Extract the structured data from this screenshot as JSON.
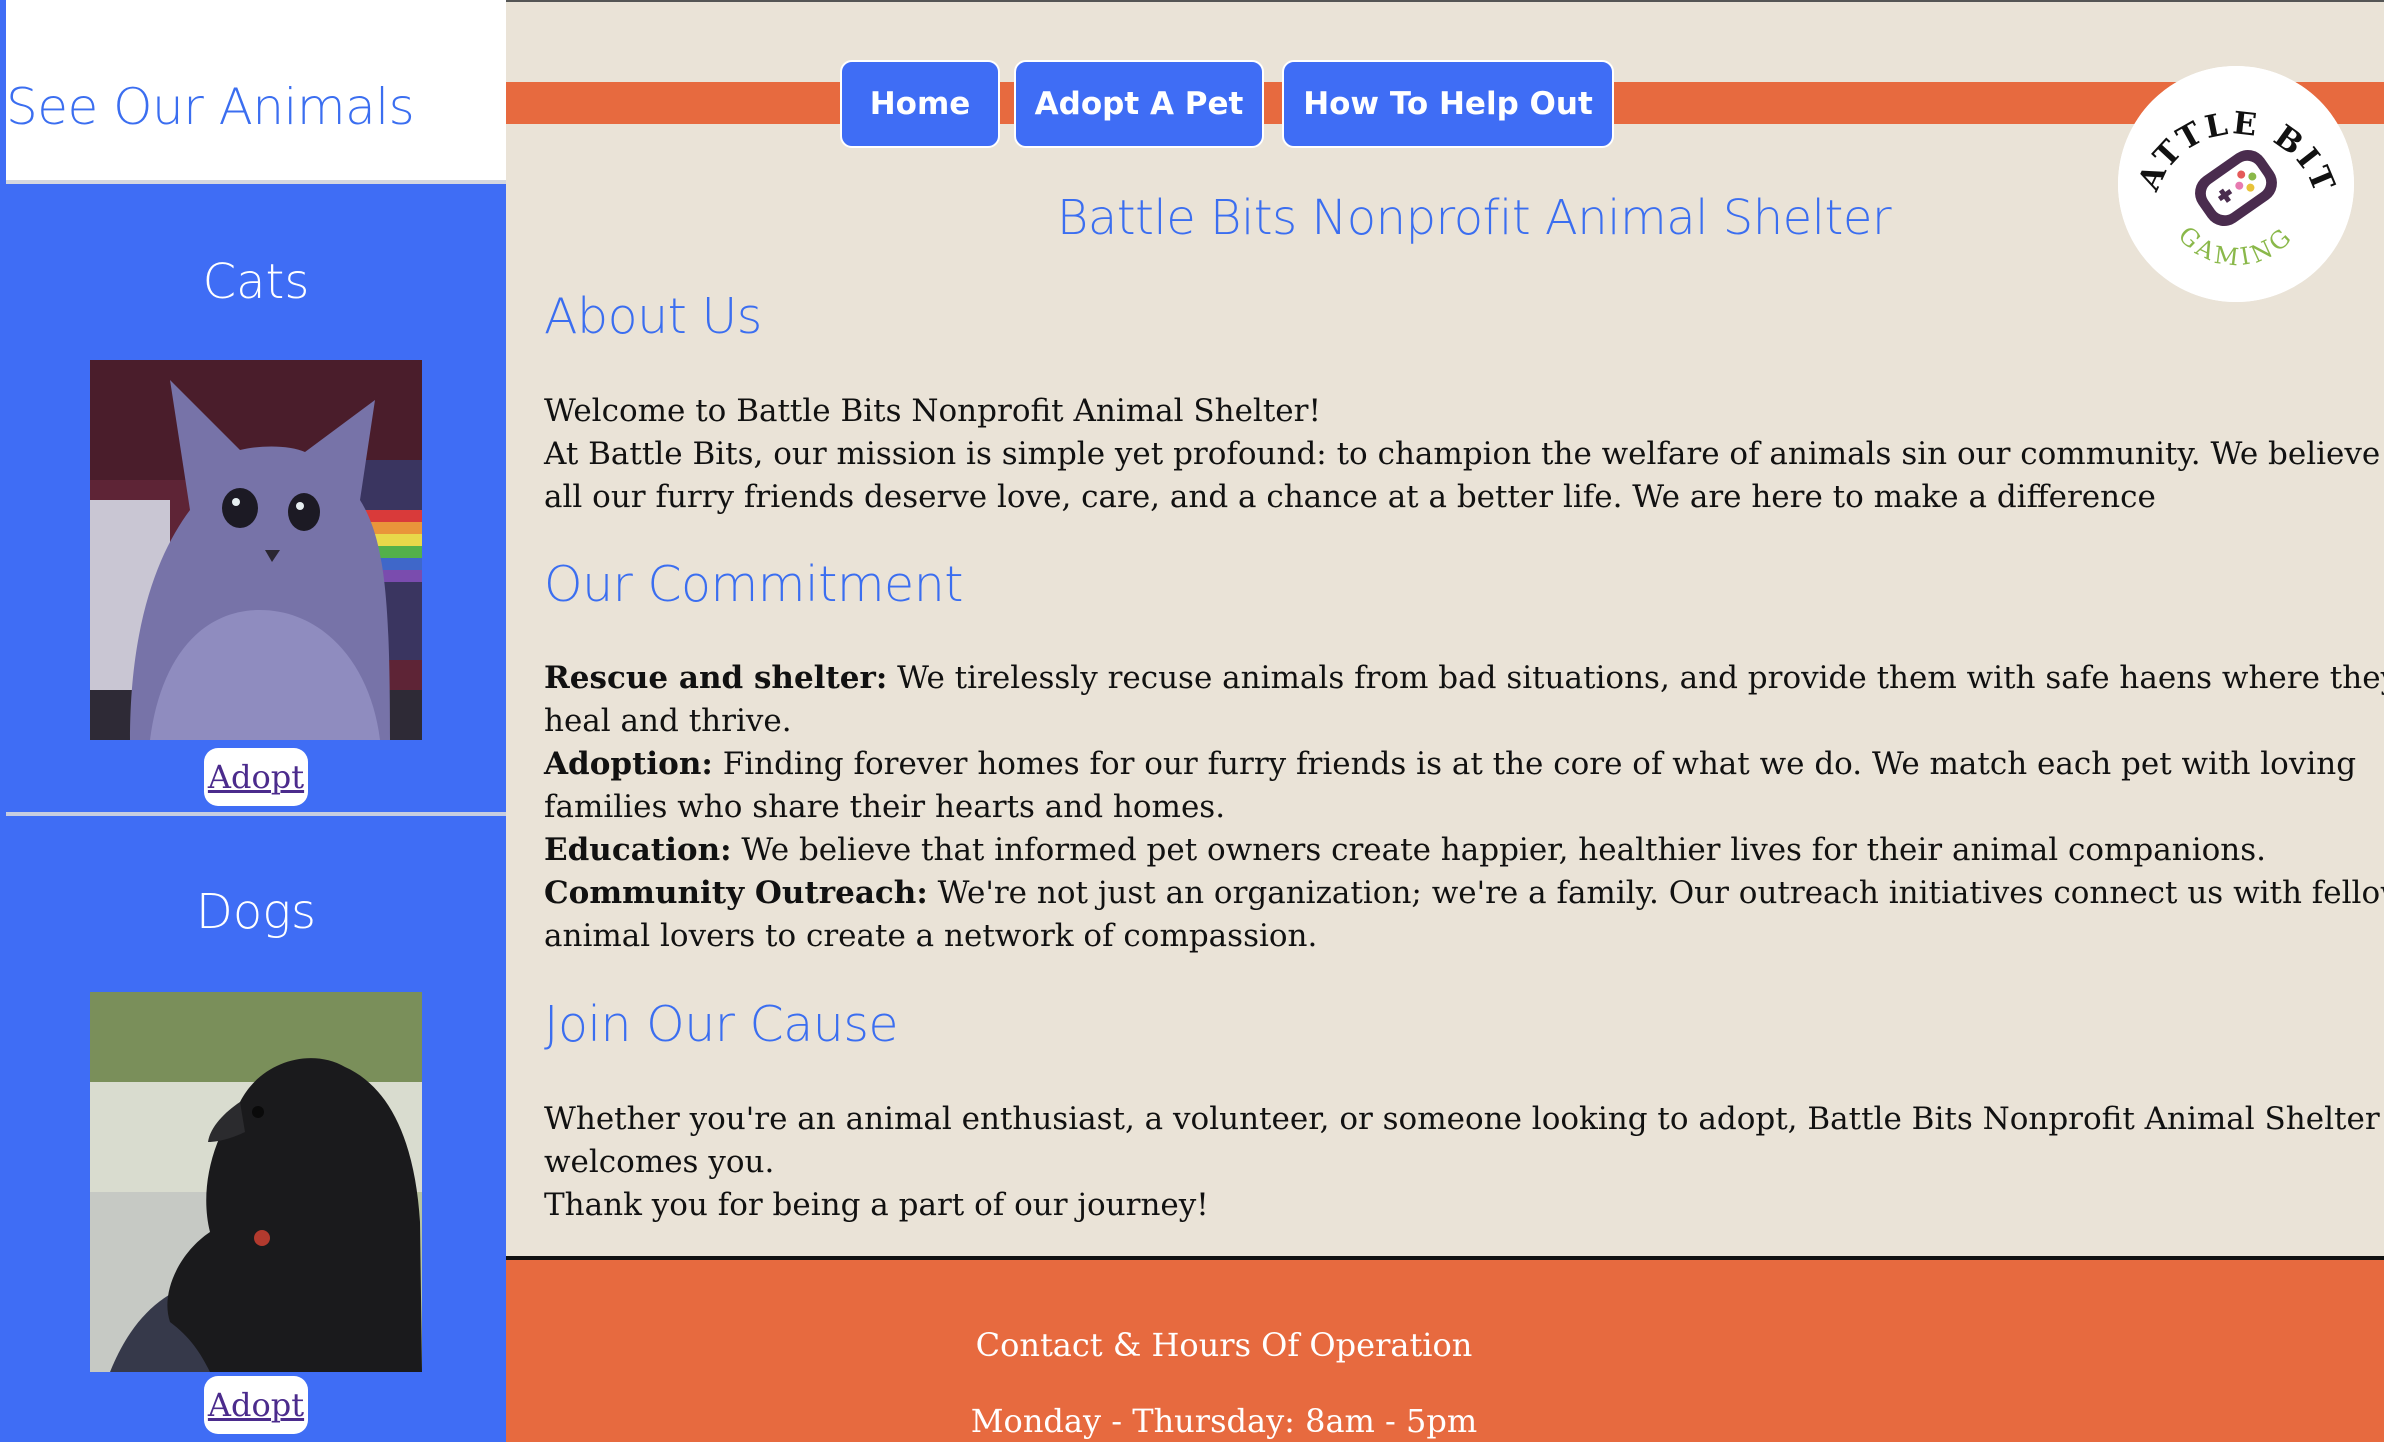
{
  "sidebar": {
    "title": "See Our Animals",
    "cards": [
      {
        "title": "Cats",
        "photo": "cat-photo",
        "adopt_label": "Adopt"
      },
      {
        "title": "Dogs",
        "photo": "dog-photo",
        "adopt_label": "Adopt"
      }
    ]
  },
  "nav": {
    "items": [
      "Home",
      "Adopt A Pet",
      "How To Help Out"
    ]
  },
  "logo": {
    "top_text": "BATTLE BITS",
    "bottom_text": "GAMING"
  },
  "main": {
    "title": "Battle Bits Nonprofit Animal Shelter",
    "about": {
      "heading": "About Us",
      "line1": "Welcome to Battle Bits Nonprofit Animal Shelter!",
      "line2": "At Battle Bits, our mission is simple yet profound: to champion the welfare of animals sin our community. We believe that",
      "line3": "all our furry friends deserve love, care, and a chance at a better life. We are here to make a difference"
    },
    "commitment": {
      "heading": "Our Commitment",
      "items": [
        {
          "label": "Rescue and shelter:",
          "text": " We tirelessly recuse animals from bad situations, and provide them with safe haens where they can",
          "cont": "heal and thrive."
        },
        {
          "label": "Adoption:",
          "text": " Finding forever homes for our furry friends is at the core of what we do. We match each pet with loving",
          "cont": "families who share their hearts and homes."
        },
        {
          "label": "Education:",
          "text": " We believe that informed pet owners create happier, healthier lives for their animal companions."
        },
        {
          "label": "Community Outreach:",
          "text": " We're not just an organization; we're a family. Our outreach initiatives connect us with fellow",
          "cont": "animal lovers to create a network of compassion."
        }
      ]
    },
    "join": {
      "heading": "Join Our Cause",
      "line1": "Whether you're an animal enthusiast, a volunteer, or someone looking to adopt, Battle Bits Nonprofit Animal Shelter",
      "line2": "welcomes you.",
      "line3": "Thank you for being a part of our journey!"
    }
  },
  "footer": {
    "heading": "Contact & Hours Of Operation",
    "hours": "Monday - Thursday: 8am - 5pm"
  },
  "colors": {
    "accent_blue": "#3f6df5",
    "accent_orange": "#e76a3f",
    "page_bg": "#eae3d7"
  }
}
